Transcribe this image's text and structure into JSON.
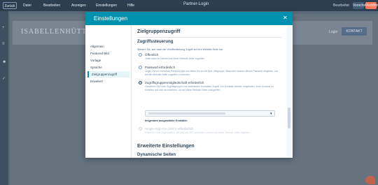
{
  "topbar": {
    "back_label": "Zurück",
    "menus": [
      "Datei",
      "Bearbeiten",
      "Anzeigen",
      "Einstellungen",
      "Hilfe"
    ],
    "page_title": "Partner-Login",
    "status": "Bearbeitet",
    "preview_label": "Vorschau",
    "publish_label": "Veröffentlichen"
  },
  "site": {
    "logo_text": "ISABELLENHÜTTE",
    "login_label": "Login",
    "cta_label": "KONTAKT"
  },
  "modal": {
    "title": "Einstellungen",
    "close_icon": "close-icon"
  },
  "nav": {
    "items": [
      {
        "label": "Allgemein"
      },
      {
        "label": "Featured Bild"
      },
      {
        "label": "Vorlage"
      },
      {
        "label": "Sprache"
      },
      {
        "label": "Zielgruppenzugriff"
      },
      {
        "label": "Erweitert"
      }
    ],
    "active_index": 4
  },
  "content": {
    "section_title": "Zielgruppenzugriff",
    "sub_title": "Zugriffssteuerung",
    "intro": "Steuern Sie, wer nach der Veröffentlichung Zugriff auf Ihre Website-Seite hat.",
    "options": [
      {
        "label": "Öffentlich",
        "desc": "Jeder kann im Internet auf diese Website-Seite zugreifen.",
        "checked": false,
        "disabled": false
      },
      {
        "label": "Passwort erforderlich",
        "desc": "Legen Sie ein einzelnes Passwort fest und teilen Sie es mit Ihrer Zielgruppe. Besucher müssen dieses Passwort eingeben, um auf die Website-Seite zugreifen zu können.",
        "checked": false,
        "disabled": false
      },
      {
        "label": "Zugriffsgruppenmitgliedschaft erforderlich",
        "desc": "Gewähren Sie Ihren Zugriffsgruppen nur bestimmten Kontakten Zugriff. Die Kontakte werden eingeladen, ihren Account zu erstellen und sich anzumelden, um auf diese Website-Seite zuzugreifen.",
        "checked": true,
        "disabled": false
      },
      {
        "label": "Single-Sign-On (SSO) erforderlich",
        "desc": "Mitglieder Ihrer Organisation, die sich mit SSO anmelden, können auf diese Website-Seite zugreifen.",
        "checked": false,
        "disabled": true
      }
    ],
    "contacts_label": "Insgesamt ausgewählte Kontakte:",
    "contacts_count": "(0)",
    "advanced_title": "Erweiterte Einstellungen",
    "dynamic_title": "Dynamische Seiten"
  }
}
